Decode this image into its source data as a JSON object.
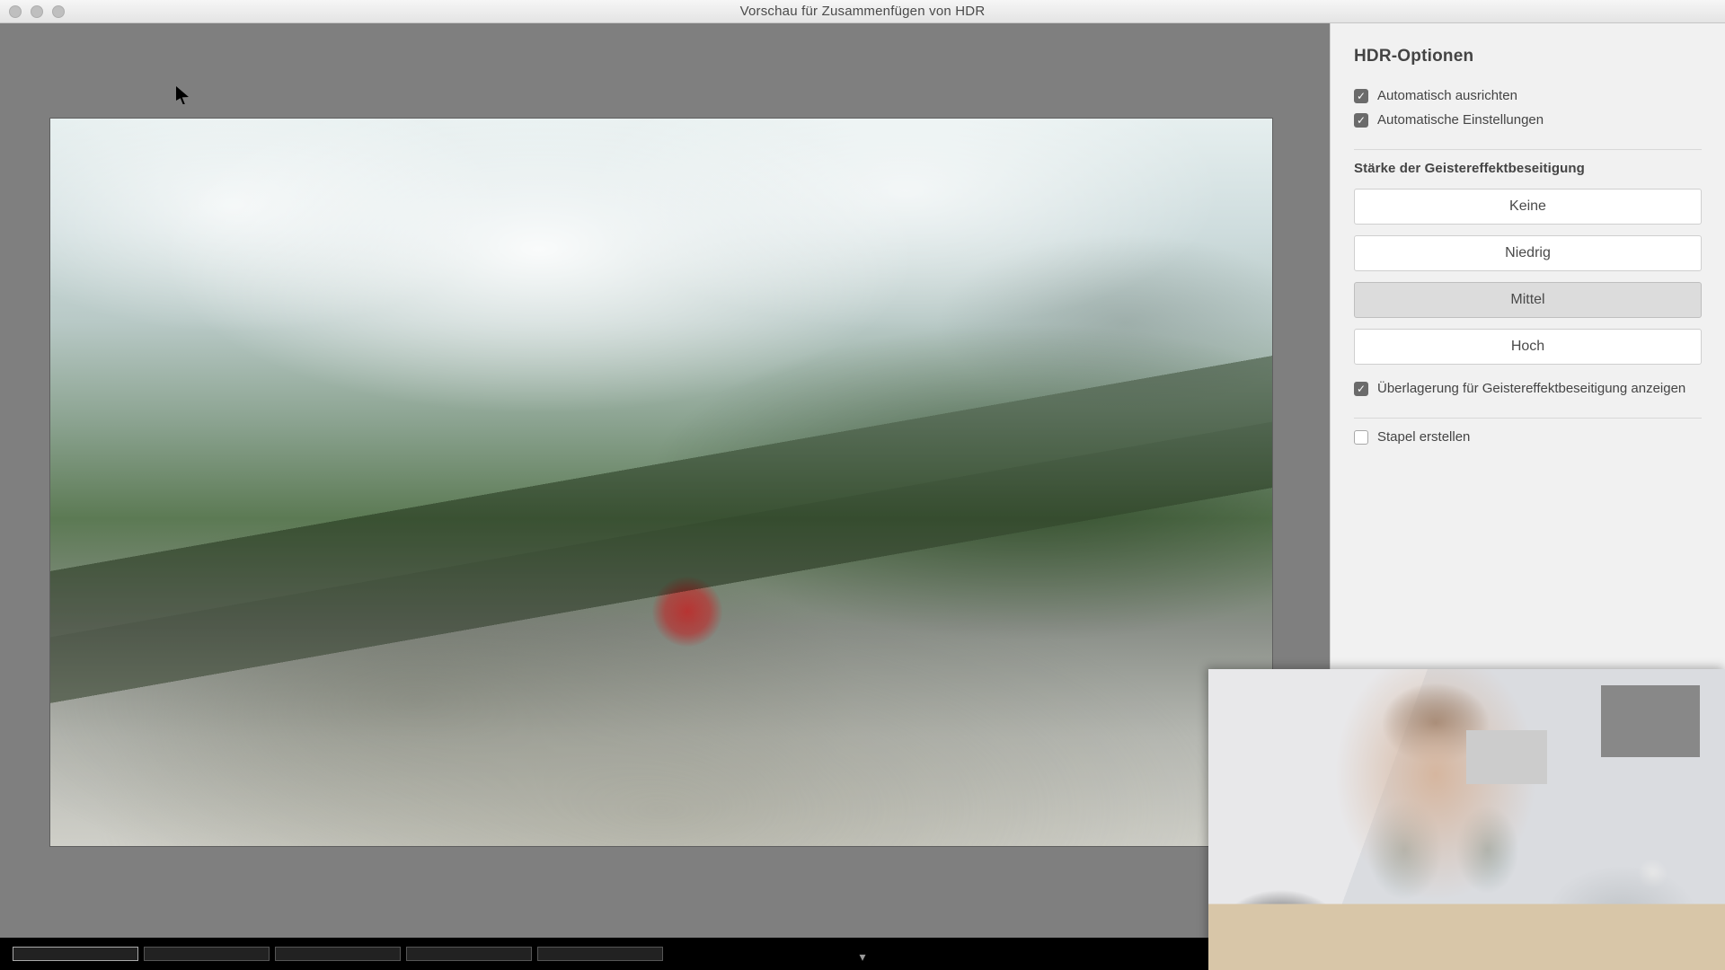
{
  "window": {
    "title": "Vorschau für Zusammenfügen von HDR"
  },
  "panel": {
    "title": "HDR-Optionen",
    "auto_align": {
      "label": "Automatisch ausrichten",
      "checked": true
    },
    "auto_settings": {
      "label": "Automatische Einstellungen",
      "checked": true
    },
    "deghost_section_label": "Stärke der Geistereffektbeseitigung",
    "deghost_options": {
      "none": "Keine",
      "low": "Niedrig",
      "medium": "Mittel",
      "high": "Hoch",
      "selected": "medium"
    },
    "show_overlay": {
      "label": "Überlagerung für Geistereffektbeseitigung anzeigen",
      "checked": true
    },
    "create_stack": {
      "label": "Stapel erstellen",
      "checked": false
    }
  }
}
